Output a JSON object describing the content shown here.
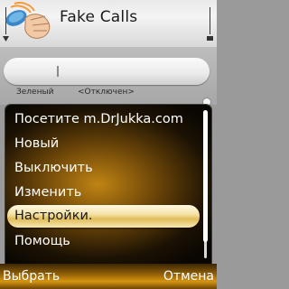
{
  "header": {
    "title": "Fake Calls",
    "icon": "phone-hand-icon"
  },
  "idle": {
    "status_left": "Зеленый",
    "status_right": "<Отключен>"
  },
  "menu": {
    "items": [
      {
        "label": "Посетите m.DrJukka.com"
      },
      {
        "label": "Новый"
      },
      {
        "label": "Выключить"
      },
      {
        "label": "Изменить"
      },
      {
        "label": "Настройки.",
        "selected": true
      },
      {
        "label": "Помощь"
      }
    ]
  },
  "softkeys": {
    "left": "Выбрать",
    "right": "Отмена"
  },
  "colors": {
    "accent": "#d59610",
    "menu_bg": "#6d4608",
    "highlight": "#f5e3a8"
  }
}
